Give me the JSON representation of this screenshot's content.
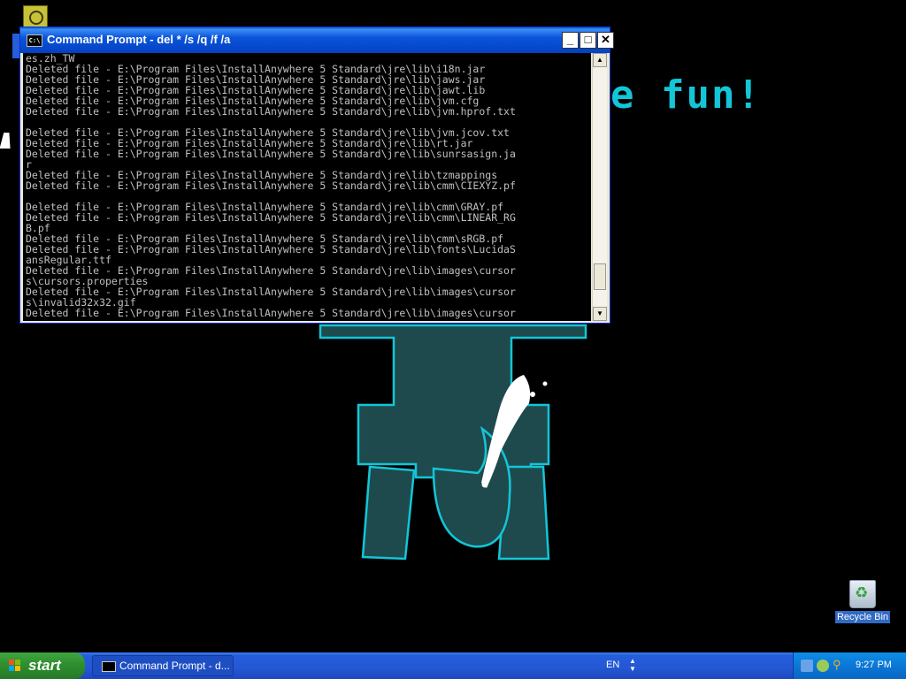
{
  "wallpaper": {
    "text": "e fun!",
    "accent_color": "#12c6d8"
  },
  "desktop": {
    "icons": [
      {
        "name": "Recycle Bin",
        "icon": "recycle-bin-icon"
      }
    ]
  },
  "cmd_window": {
    "title": "Command Prompt - del * /s /q /f /a",
    "icon": "cmd-icon",
    "lines": [
      "es.zh_TW",
      "Deleted file - E:\\Program Files\\InstallAnywhere 5 Standard\\jre\\lib\\i18n.jar",
      "Deleted file - E:\\Program Files\\InstallAnywhere 5 Standard\\jre\\lib\\jaws.jar",
      "Deleted file - E:\\Program Files\\InstallAnywhere 5 Standard\\jre\\lib\\jawt.lib",
      "Deleted file - E:\\Program Files\\InstallAnywhere 5 Standard\\jre\\lib\\jvm.cfg",
      "Deleted file - E:\\Program Files\\InstallAnywhere 5 Standard\\jre\\lib\\jvm.hprof.txt",
      "",
      "Deleted file - E:\\Program Files\\InstallAnywhere 5 Standard\\jre\\lib\\jvm.jcov.txt",
      "Deleted file - E:\\Program Files\\InstallAnywhere 5 Standard\\jre\\lib\\rt.jar",
      "Deleted file - E:\\Program Files\\InstallAnywhere 5 Standard\\jre\\lib\\sunrsasign.ja",
      "r",
      "Deleted file - E:\\Program Files\\InstallAnywhere 5 Standard\\jre\\lib\\tzmappings",
      "Deleted file - E:\\Program Files\\InstallAnywhere 5 Standard\\jre\\lib\\cmm\\CIEXYZ.pf",
      "",
      "Deleted file - E:\\Program Files\\InstallAnywhere 5 Standard\\jre\\lib\\cmm\\GRAY.pf",
      "Deleted file - E:\\Program Files\\InstallAnywhere 5 Standard\\jre\\lib\\cmm\\LINEAR_RG",
      "B.pf",
      "Deleted file - E:\\Program Files\\InstallAnywhere 5 Standard\\jre\\lib\\cmm\\sRGB.pf",
      "Deleted file - E:\\Program Files\\InstallAnywhere 5 Standard\\jre\\lib\\fonts\\LucidaS",
      "ansRegular.ttf",
      "Deleted file - E:\\Program Files\\InstallAnywhere 5 Standard\\jre\\lib\\images\\cursor",
      "s\\cursors.properties",
      "Deleted file - E:\\Program Files\\InstallAnywhere 5 Standard\\jre\\lib\\images\\cursor",
      "s\\invalid32x32.gif",
      "Deleted file - E:\\Program Files\\InstallAnywhere 5 Standard\\jre\\lib\\images\\cursor"
    ],
    "buttons": {
      "minimize": "_",
      "maximize": "□",
      "close": "✕"
    },
    "scroll_fraction": 0.92
  },
  "taskbar": {
    "start_label": "start",
    "tasks": [
      {
        "label": "Command Prompt - d...",
        "icon": "cmd-icon"
      }
    ],
    "language": "EN",
    "tray_icons": [
      "network-icon",
      "volume-icon",
      "search-icon"
    ],
    "clock": "9:27 PM"
  },
  "colors": {
    "taskbar": "#245edb",
    "start_button": "#2f8e2f",
    "titlebar": "#0a54d9",
    "console_text": "#c0c0c0"
  }
}
